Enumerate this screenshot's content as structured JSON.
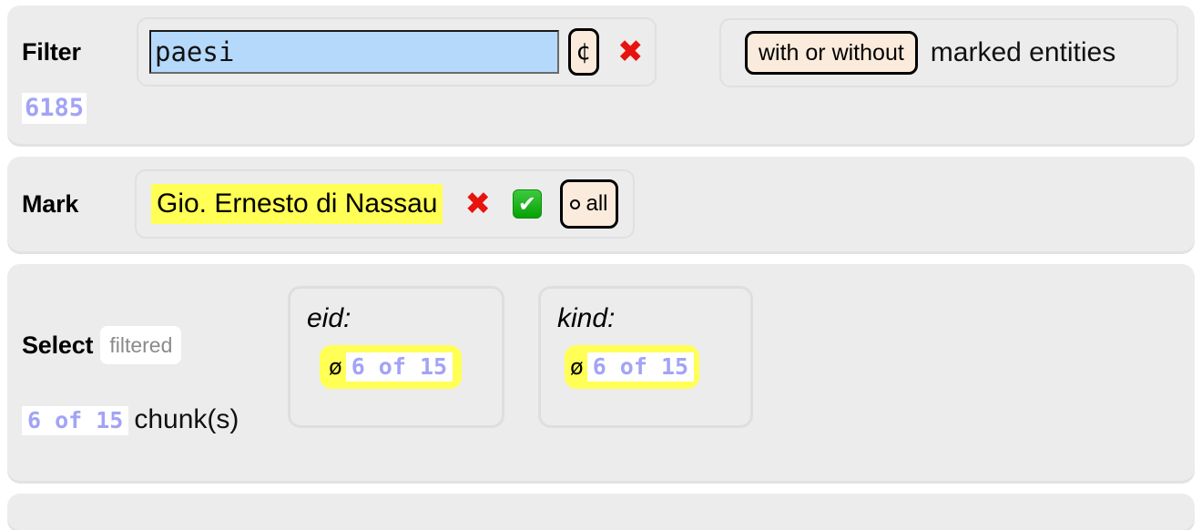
{
  "filter": {
    "label": "Filter",
    "input_value": "paesi",
    "input_placeholder": "",
    "currency_button": "¢",
    "clear_icon": "✖",
    "match_count": "6185",
    "entity_toggle": "with or without",
    "entity_suffix": "marked entities"
  },
  "mark": {
    "label": "Mark",
    "chip": "Gio. Ernesto di Nassau",
    "clear_icon": "✖",
    "confirm_icon": "✔",
    "all_button": "all"
  },
  "select": {
    "label": "Select",
    "mode_badge": "filtered",
    "chunk_count": "6 of 15",
    "chunk_label": "chunk(s)",
    "fields": [
      {
        "name": "eid:",
        "null_symbol": "ø",
        "count": "6 of 15"
      },
      {
        "name": "kind:",
        "null_symbol": "ø",
        "count": "6 of 15"
      }
    ]
  },
  "colors": {
    "panel_bg": "#ececec",
    "input_bg": "#b5d9fb",
    "highlight_yellow": "#ffff55",
    "button_cream": "#faebdc",
    "count_purple": "#a3a3f5",
    "clear_red": "#e8120e",
    "confirm_green": "#06a206"
  }
}
